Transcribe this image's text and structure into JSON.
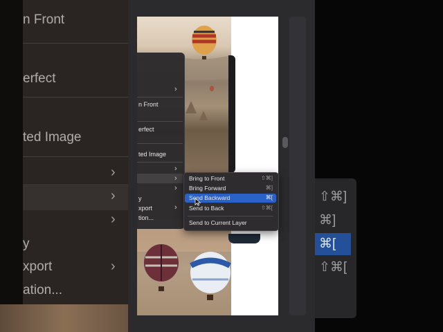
{
  "background_left": {
    "items": [
      "n Front",
      "erfect",
      "ted Image",
      "y",
      "xport",
      "ation..."
    ]
  },
  "context_menu": {
    "items": [
      "n Front",
      "erfect",
      "ted Image",
      "y",
      "xport",
      "tion..."
    ]
  },
  "submenu": {
    "items": [
      {
        "label": "Bring to Front",
        "shortcut": "⇧⌘]"
      },
      {
        "label": "Bring Forward",
        "shortcut": "⌘]"
      },
      {
        "label": "Send Backward",
        "shortcut": "⌘["
      },
      {
        "label": "Send to Back",
        "shortcut": "⇧⌘["
      },
      {
        "label": "Send to Current Layer",
        "shortcut": ""
      }
    ]
  },
  "background_right": {
    "shortcuts": [
      "⇧⌘]",
      "⌘]",
      "⌘[",
      "⇧⌘["
    ]
  },
  "colors": {
    "highlight": "#2a62c9",
    "menu_bg": "#2e2c2e"
  },
  "icons": {
    "chevron": "chevron-right-icon",
    "cursor": "mouse-pointer-icon"
  }
}
